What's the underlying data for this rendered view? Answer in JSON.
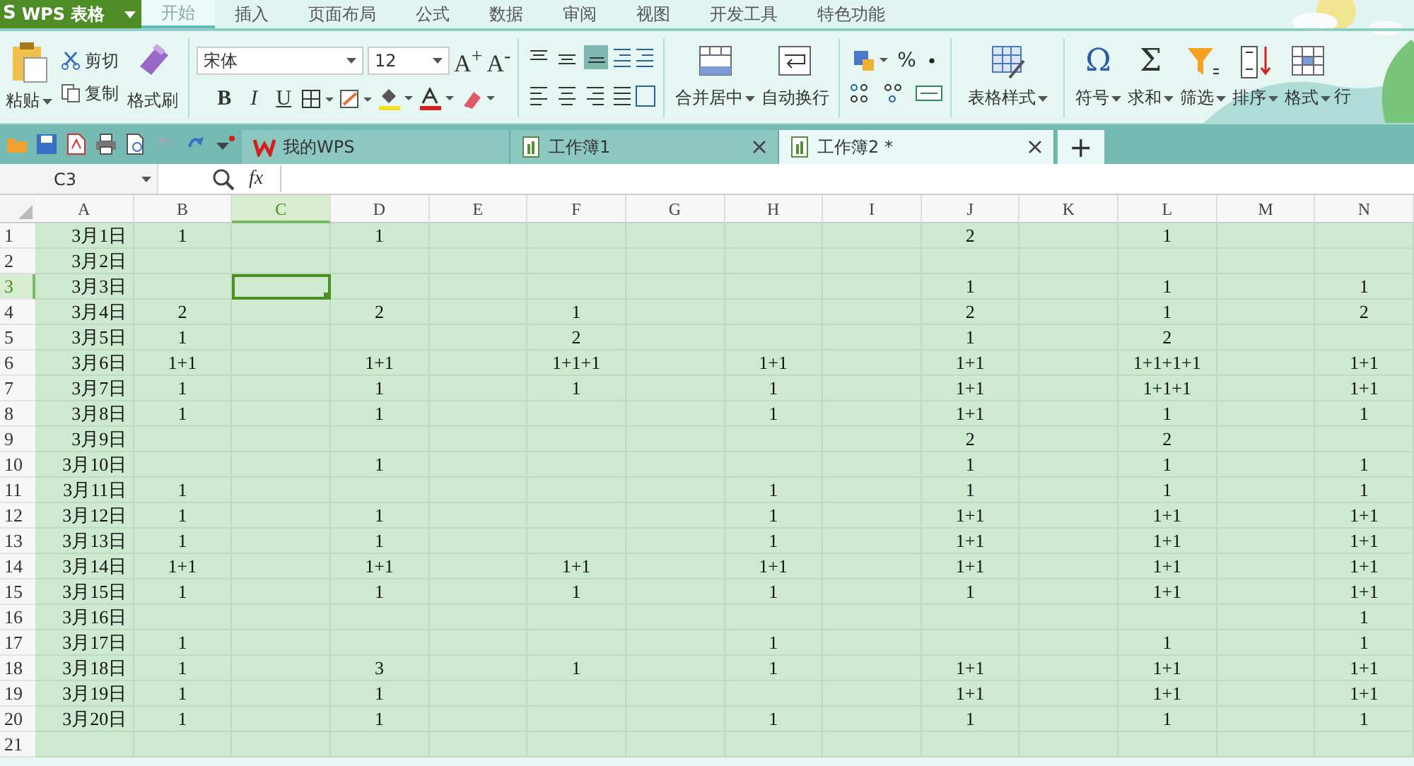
{
  "app_button": {
    "logo": "S",
    "label": "WPS 表格"
  },
  "menu_tabs": [
    {
      "label": "开始",
      "selected": true
    },
    {
      "label": "插入",
      "selected": false
    },
    {
      "label": "页面布局",
      "selected": false
    },
    {
      "label": "公式",
      "selected": false
    },
    {
      "label": "数据",
      "selected": false
    },
    {
      "label": "审阅",
      "selected": false
    },
    {
      "label": "视图",
      "selected": false
    },
    {
      "label": "开发工具",
      "selected": false
    },
    {
      "label": "特色功能",
      "selected": false
    }
  ],
  "ribbon": {
    "paste": "粘贴",
    "cut": "剪切",
    "copy": "复制",
    "format_painter": "格式刷",
    "font": "宋体",
    "font_size": "12",
    "grow_glyph": "A$^{+}$",
    "shrink_glyph": "A$^{-}$",
    "bold": "B",
    "italic": "I",
    "underline": "U",
    "merge": "合并居中",
    "wrap": "自动换行",
    "percent": "%",
    "table_style": "表格样式",
    "symbol_glyph": "Ω",
    "symbol": "符号",
    "sum_glyph": "Σ",
    "sum": "求和",
    "filter": "筛选",
    "sort": "排序",
    "format": "格式",
    "row_col": "行"
  },
  "doc_tabs": [
    {
      "label": "我的WPS",
      "kind": "home",
      "selected": false,
      "closable": false
    },
    {
      "label": "工作簿1",
      "kind": "book",
      "selected": false,
      "closable": true
    },
    {
      "label": "工作簿2 *",
      "kind": "book",
      "selected": true,
      "closable": true
    }
  ],
  "new_tab": "+",
  "formula_bar": {
    "name_box": "C3",
    "fx": "fx"
  },
  "sheet": {
    "columns": [
      {
        "label": "A",
        "selected": false
      },
      {
        "label": "B",
        "selected": false
      },
      {
        "label": "C",
        "selected": true
      },
      {
        "label": "D",
        "selected": false
      },
      {
        "label": "E",
        "selected": false
      },
      {
        "label": "F",
        "selected": false
      },
      {
        "label": "G",
        "selected": false
      },
      {
        "label": "H",
        "selected": false
      },
      {
        "label": "I",
        "selected": false
      },
      {
        "label": "J",
        "selected": false
      },
      {
        "label": "K",
        "selected": false
      },
      {
        "label": "L",
        "selected": false
      },
      {
        "label": "M",
        "selected": false
      },
      {
        "label": "N",
        "selected": false
      }
    ],
    "rows": [
      {
        "label": "1",
        "selected": false,
        "cells": {
          "A": "3月1日",
          "B": "1",
          "D": "1",
          "J": "2",
          "L": "1"
        }
      },
      {
        "label": "2",
        "selected": false,
        "cells": {
          "A": "3月2日"
        }
      },
      {
        "label": "3",
        "selected": true,
        "cells": {
          "A": "3月3日",
          "J": "1",
          "L": "1",
          "N": "1"
        }
      },
      {
        "label": "4",
        "selected": false,
        "cells": {
          "A": "3月4日",
          "B": "2",
          "D": "2",
          "F": "1",
          "J": "2",
          "L": "1",
          "N": "2"
        }
      },
      {
        "label": "5",
        "selected": false,
        "cells": {
          "A": "3月5日",
          "B": "1",
          "F": "2",
          "J": "1",
          "L": "2"
        }
      },
      {
        "label": "6",
        "selected": false,
        "cells": {
          "A": "3月6日",
          "B": "1+1",
          "D": "1+1",
          "F": "1+1+1",
          "H": "1+1",
          "J": "1+1",
          "L": "1+1+1+1",
          "N": "1+1"
        }
      },
      {
        "label": "7",
        "selected": false,
        "cells": {
          "A": "3月7日",
          "B": "1",
          "D": "1",
          "F": "1",
          "H": "1",
          "J": "1+1",
          "L": "1+1+1",
          "N": "1+1"
        }
      },
      {
        "label": "8",
        "selected": false,
        "cells": {
          "A": "3月8日",
          "B": "1",
          "D": "1",
          "H": "1",
          "J": "1+1",
          "L": "1",
          "N": "1"
        }
      },
      {
        "label": "9",
        "selected": false,
        "cells": {
          "A": "3月9日",
          "J": "2",
          "L": "2"
        }
      },
      {
        "label": "10",
        "selected": false,
        "cells": {
          "A": "3月10日",
          "D": "1",
          "J": "1",
          "L": "1",
          "N": "1"
        }
      },
      {
        "label": "11",
        "selected": false,
        "cells": {
          "A": "3月11日",
          "B": "1",
          "H": "1",
          "J": "1",
          "L": "1",
          "N": "1"
        }
      },
      {
        "label": "12",
        "selected": false,
        "cells": {
          "A": "3月12日",
          "B": "1",
          "D": "1",
          "H": "1",
          "J": "1+1",
          "L": "1+1",
          "N": "1+1"
        }
      },
      {
        "label": "13",
        "selected": false,
        "cells": {
          "A": "3月13日",
          "B": "1",
          "D": "1",
          "H": "1",
          "J": "1+1",
          "L": "1+1",
          "N": "1+1"
        }
      },
      {
        "label": "14",
        "selected": false,
        "cells": {
          "A": "3月14日",
          "B": "1+1",
          "D": "1+1",
          "F": "1+1",
          "H": "1+1",
          "J": "1+1",
          "L": "1+1",
          "N": "1+1"
        }
      },
      {
        "label": "15",
        "selected": false,
        "cells": {
          "A": "3月15日",
          "B": "1",
          "D": "1",
          "F": "1",
          "H": "1",
          "J": "1",
          "L": "1+1",
          "N": "1+1"
        }
      },
      {
        "label": "16",
        "selected": false,
        "cells": {
          "A": "3月16日",
          "N": "1"
        }
      },
      {
        "label": "17",
        "selected": false,
        "cells": {
          "A": "3月17日",
          "B": "1",
          "H": "1",
          "L": "1",
          "N": "1"
        }
      },
      {
        "label": "18",
        "selected": false,
        "cells": {
          "A": "3月18日",
          "B": "1",
          "D": "3",
          "F": "1",
          "H": "1",
          "J": "1+1",
          "L": "1+1",
          "N": "1+1"
        }
      },
      {
        "label": "19",
        "selected": false,
        "cells": {
          "A": "3月19日",
          "B": "1",
          "D": "1",
          "J": "1+1",
          "L": "1+1",
          "N": "1+1"
        }
      },
      {
        "label": "20",
        "selected": false,
        "cells": {
          "A": "3月20日",
          "B": "1",
          "D": "1",
          "H": "1",
          "J": "1",
          "L": "1",
          "N": "1"
        }
      },
      {
        "label": "21",
        "selected": false
      }
    ]
  }
}
